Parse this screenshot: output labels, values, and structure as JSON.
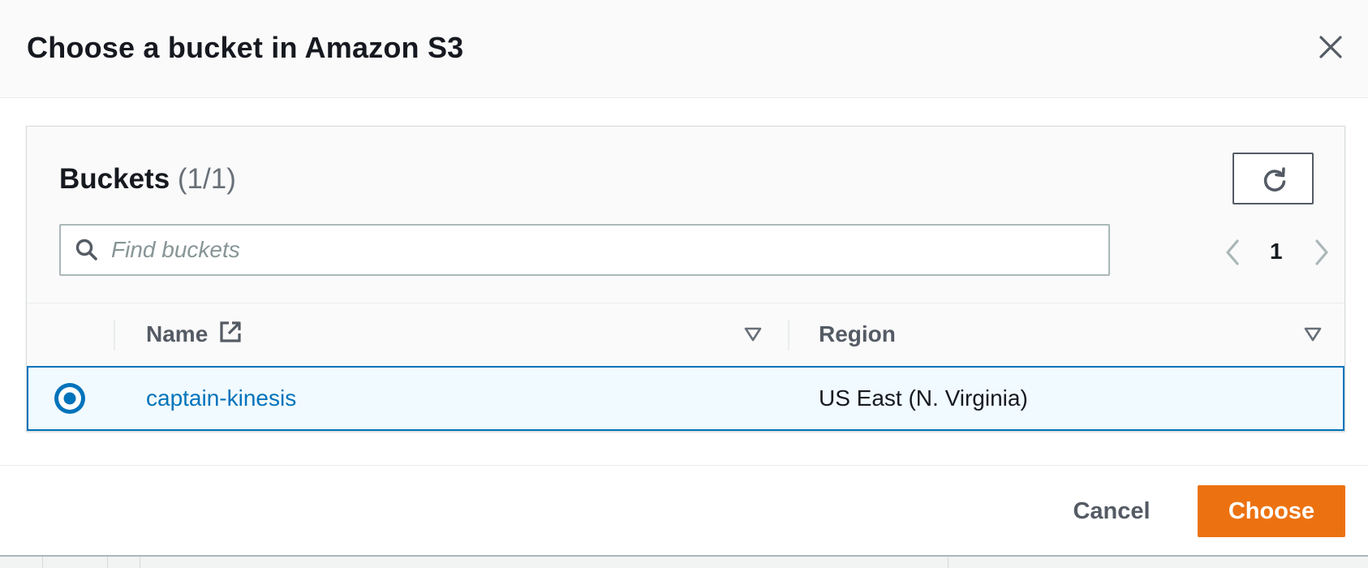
{
  "modal": {
    "title": "Choose a bucket in Amazon S3",
    "close_icon": "close-icon"
  },
  "buckets": {
    "heading": "Buckets",
    "count": "(1/1)",
    "refresh_icon": "refresh-icon",
    "search": {
      "placeholder": "Find buckets",
      "value": "",
      "icon": "search-icon"
    },
    "pagination": {
      "current_page": "1",
      "prev_icon": "chevron-left-icon",
      "next_icon": "chevron-right-icon"
    },
    "columns": [
      {
        "label": "Name",
        "icon": "external-link-icon",
        "sort_icon": "sort-down-icon"
      },
      {
        "label": "Region",
        "sort_icon": "sort-down-icon"
      }
    ],
    "rows": [
      {
        "name": "captain-kinesis",
        "region": "US East (N. Virginia)",
        "selected": true
      }
    ]
  },
  "footer": {
    "cancel_label": "Cancel",
    "choose_label": "Choose"
  },
  "colors": {
    "accent": "#ec7211",
    "link": "#0073bb",
    "selected_row_bg": "#f1faff"
  }
}
